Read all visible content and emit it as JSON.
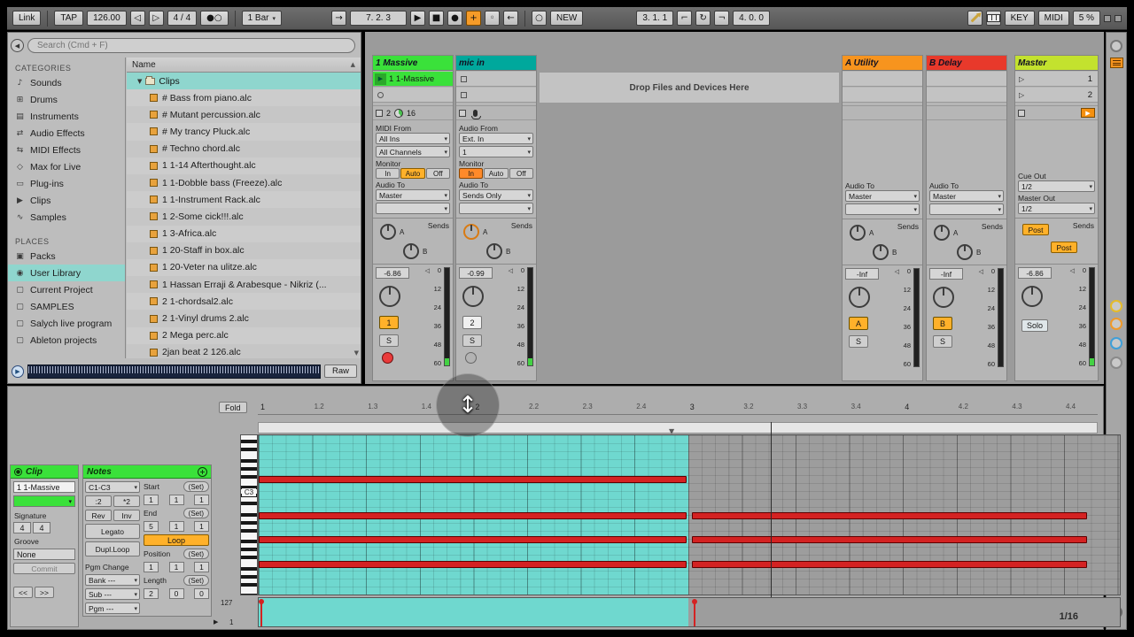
{
  "icons": {
    "collapse_circle": "◀",
    "nudge_down": "◁",
    "nudge_up": "▷",
    "metronome": "●○",
    "follow": "→",
    "play": "▶",
    "stop": "■",
    "record": "●",
    "overdub": "+",
    "automation_arm": "◦",
    "reenable_automation": "←",
    "session_record": "○",
    "punch_in": "⌐",
    "loop": "↻",
    "punch_out": "¬",
    "sort_asc": "▲",
    "scroll_down": "▼",
    "expand_open": "▼",
    "clip_play": "▶",
    "scene_play": "▷",
    "peak_indicator": "◁",
    "velocity_fold": "▶",
    "add_plus": "+",
    "loop_end_marker": "▼",
    "move_cursor": "↕",
    "preview_play": "▶",
    "launch_dot": "●"
  },
  "transport": {
    "link": "Link",
    "tap": "TAP",
    "tempo": "126.00",
    "time_signature": "4 / 4",
    "quantize": "1 Bar",
    "position": "7. 2. 3",
    "new_label": "NEW",
    "loop_start": "3. 1. 1",
    "loop_length": "4. 0. 0",
    "key": "KEY",
    "midi": "MIDI",
    "cpu": "5 %"
  },
  "browser": {
    "search_placeholder": "Search (Cmd + F)",
    "categories_title": "CATEGORIES",
    "categories": [
      {
        "label": "Sounds",
        "icon": "♪",
        "icon_name": "note-icon"
      },
      {
        "label": "Drums",
        "icon": "⊞",
        "icon_name": "drum-pads-icon"
      },
      {
        "label": "Instruments",
        "icon": "▤",
        "icon_name": "instrument-keys-icon"
      },
      {
        "label": "Audio Effects",
        "icon": "⇄",
        "icon_name": "audio-effects-icon"
      },
      {
        "label": "MIDI Effects",
        "icon": "⇆",
        "icon_name": "midi-effects-icon"
      },
      {
        "label": "Max for Live",
        "icon": "◇",
        "icon_name": "max-for-live-icon"
      },
      {
        "label": "Plug-ins",
        "icon": "▭",
        "icon_name": "plug-icon"
      },
      {
        "label": "Clips",
        "icon": "▶",
        "icon_name": "clip-icon"
      },
      {
        "label": "Samples",
        "icon": "∿",
        "icon_name": "waveform-icon"
      }
    ],
    "places_title": "PLACES",
    "places": [
      {
        "label": "Packs",
        "icon": "▣",
        "icon_name": "packs-icon",
        "selected": false
      },
      {
        "label": "User Library",
        "icon": "◉",
        "icon_name": "user-library-icon",
        "selected": true
      },
      {
        "label": "Current Project",
        "icon": "▢",
        "icon_name": "folder-icon",
        "selected": false
      },
      {
        "label": "SAMPLES",
        "icon": "▢",
        "icon_name": "folder-icon",
        "selected": false
      },
      {
        "label": "Salych live program",
        "icon": "▢",
        "icon_name": "folder-icon",
        "selected": false
      },
      {
        "label": "Ableton projects",
        "icon": "▢",
        "icon_name": "folder-icon",
        "selected": false
      }
    ],
    "list_header": "Name",
    "folder_label": "Clips",
    "files": [
      "# Bass from piano.alc",
      "# Mutant percussion.alc",
      "# My trancy Pluck.alc",
      "# Techno chord.alc",
      "1 1-14 Afterthought.alc",
      "1 1-Dobble bass (Freeze).alc",
      "1 1-Instrument Rack.alc",
      "1 2-Some cick!!!.alc",
      "1 3-Africa.alc",
      "1 20-Staff in box.alc",
      "1 20-Veter na ulitze.alc",
      "1 Hassan Erraji & Arabesque - Nikriz (...",
      "2 1-chordsal2.alc",
      "2 1-Vinyl drums 2.alc",
      "2 Mega perc.alc",
      "2jan beat 2 126.alc"
    ],
    "preview_button": "Raw"
  },
  "session": {
    "drop_text": "Drop Files and Devices Here",
    "meter_scale": [
      "0",
      "12",
      "24",
      "36",
      "48",
      "60"
    ],
    "tracks": [
      {
        "name": "1 Massive",
        "color": "#3ae13a",
        "clip": "1 1-Massive",
        "status_left": "2",
        "status_right": "16",
        "in_label": "MIDI From",
        "in_value": "All Ins",
        "channel_value": "All Channels",
        "monitor_label": "Monitor",
        "mon_in": "In",
        "mon_auto": "Auto",
        "mon_off": "Off",
        "out_label": "Audio To",
        "out_value": "Master",
        "sends_label": "Sends",
        "send_a": "A",
        "send_b": "B",
        "volume": "-6.86",
        "number": "1",
        "solo": "S"
      },
      {
        "name": "mic in",
        "color": "#00a89c",
        "in_label": "Audio From",
        "in_value": "Ext. In",
        "channel_value": "1",
        "monitor_label": "Monitor",
        "mon_in": "In",
        "mon_auto": "Auto",
        "mon_off": "Off",
        "out_label": "Audio To",
        "out_value": "Sends Only",
        "sends_label": "Sends",
        "send_a": "A",
        "send_b": "B",
        "volume": "-0.99",
        "number": "2",
        "solo": "S"
      }
    ],
    "returns": [
      {
        "name": "A Utility",
        "color": "#f7941e",
        "out_label": "Audio To",
        "out_value": "Master",
        "sends_label": "Sends",
        "send_a": "A",
        "send_b": "B",
        "volume": "-Inf",
        "number": "A",
        "solo": "S"
      },
      {
        "name": "B Delay",
        "color": "#e8392b",
        "out_label": "Audio To",
        "out_value": "Master",
        "sends_label": "Sends",
        "send_a": "A",
        "send_b": "B",
        "volume": "-Inf",
        "number": "B",
        "solo": "S"
      }
    ],
    "master": {
      "name": "Master",
      "color": "#c3e22e",
      "scenes": [
        "1",
        "2"
      ],
      "cue_label": "Cue Out",
      "cue_value": "1/2",
      "out_label": "Master Out",
      "out_value": "1/2",
      "post_a": "Post",
      "post_b": "Post",
      "sends_label": "Sends",
      "volume": "-6.86",
      "solo_label": "Solo"
    }
  },
  "clip_panel": {
    "header": "Clip",
    "name": "1 1-Massive",
    "signature_label": "Signature",
    "sig_num": "4",
    "sig_den": "4",
    "groove_label": "Groove",
    "groove": "None",
    "commit": "Commit",
    "prev": "<<",
    "next": ">>"
  },
  "notes_panel": {
    "header": "Notes",
    "fold_range": "C1-C3",
    "half": ":2",
    "double": "*2",
    "rev": "Rev",
    "inv": "Inv",
    "legato": "Legato",
    "dupl": "Dupl.Loop",
    "set": "(Set)",
    "start_label": "Start",
    "start": [
      "1",
      "1",
      "1"
    ],
    "end_label": "End",
    "end": [
      "5",
      "1",
      "1"
    ],
    "loop_label": "Loop",
    "position_label": "Position",
    "position": [
      "1",
      "1",
      "1"
    ],
    "length_label": "Length",
    "length": [
      "2",
      "0",
      "0"
    ],
    "pgm_change_label": "Pgm Change",
    "bank": "Bank ---",
    "sub": "Sub ---",
    "pgm": "Pgm ---"
  },
  "piano_roll": {
    "fold_button": "Fold",
    "ticks": [
      "1",
      "1.2",
      "1.3",
      "1.4",
      "2",
      "2.2",
      "2.3",
      "2.4",
      "3",
      "3.2",
      "3.3",
      "3.4",
      "4",
      "4.2",
      "4.3",
      "4.4"
    ],
    "pitch_label": "C3",
    "velocity_max": "127",
    "velocity_min": "1",
    "grid_label": "1/16",
    "loop_beats": 8,
    "notes": [
      {
        "row": 0,
        "start": 0,
        "len": 8
      },
      {
        "row": 1,
        "start": 0,
        "len": 8
      },
      {
        "row": 1,
        "start": 8.07,
        "len": 7.4
      },
      {
        "row": 2,
        "start": 0,
        "len": 8
      },
      {
        "row": 2,
        "start": 8.07,
        "len": 7.4
      },
      {
        "row": 3,
        "start": 0,
        "len": 8
      },
      {
        "row": 3,
        "start": 8.07,
        "len": 7.4
      }
    ],
    "velocity_markers": [
      {
        "beat": 0
      },
      {
        "beat": 8.07
      }
    ]
  }
}
